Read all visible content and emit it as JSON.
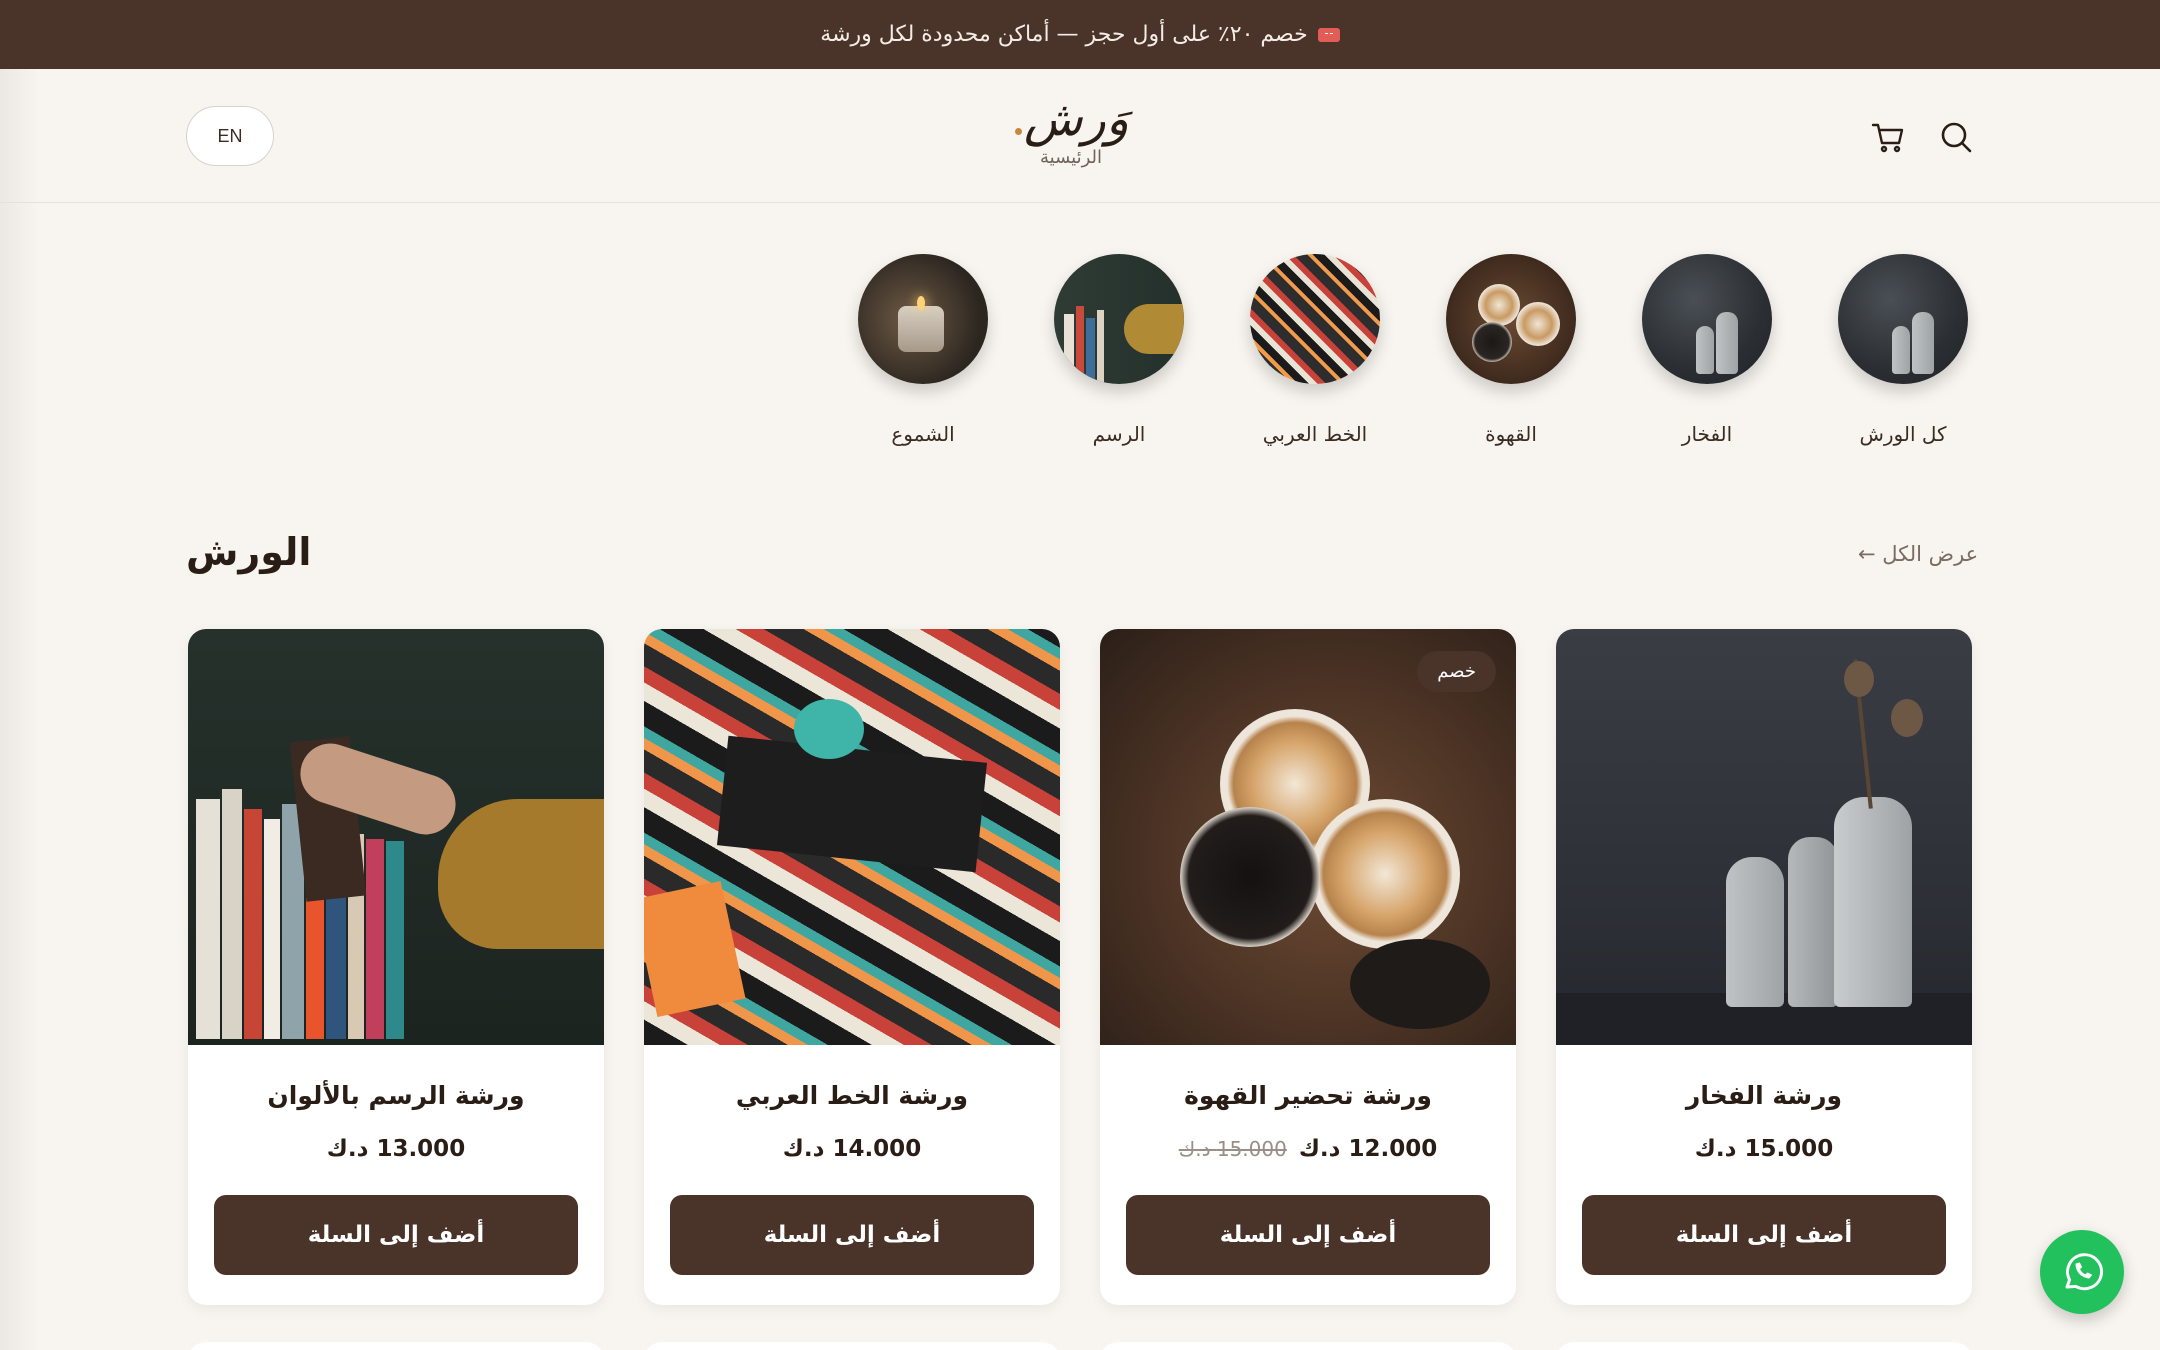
{
  "announcement": {
    "text": "خصم ٢٠٪ على أول حجز — أماكن محدودة لكل ورشة",
    "icon": "ticket-icon"
  },
  "header": {
    "lang_button": "EN",
    "logo_text": "وَرش",
    "logo_subtitle": "الرئيسية",
    "icons": [
      "cart-icon",
      "search-icon"
    ]
  },
  "categories": [
    {
      "label": "كل الورش"
    },
    {
      "label": "الفخار"
    },
    {
      "label": "القهوة"
    },
    {
      "label": "الخط العربي"
    },
    {
      "label": "الرسم"
    },
    {
      "label": "الشموع"
    }
  ],
  "section": {
    "title": "الورش",
    "view_all": "عرض الكل ←"
  },
  "products": [
    {
      "title": "ورشة الرسم بالألوان",
      "price": "13.000 د.ك",
      "old_price": "",
      "button": "أضف إلى السلة"
    },
    {
      "title": "ورشة الخط العربي",
      "price": "14.000 د.ك",
      "old_price": "",
      "button": "أضف إلى السلة"
    },
    {
      "title": "ورشة تحضير القهوة",
      "price": "12.000 د.ك",
      "old_price": "15.000 د.ك",
      "badge": "خصم",
      "button": "أضف إلى السلة"
    },
    {
      "title": "ورشة الفخار",
      "price": "15.000 د.ك",
      "old_price": "",
      "button": "أضف إلى السلة"
    }
  ],
  "colors": {
    "brand": "#4a3328",
    "background": "#f8f5f0",
    "whatsapp": "#22c15e"
  }
}
